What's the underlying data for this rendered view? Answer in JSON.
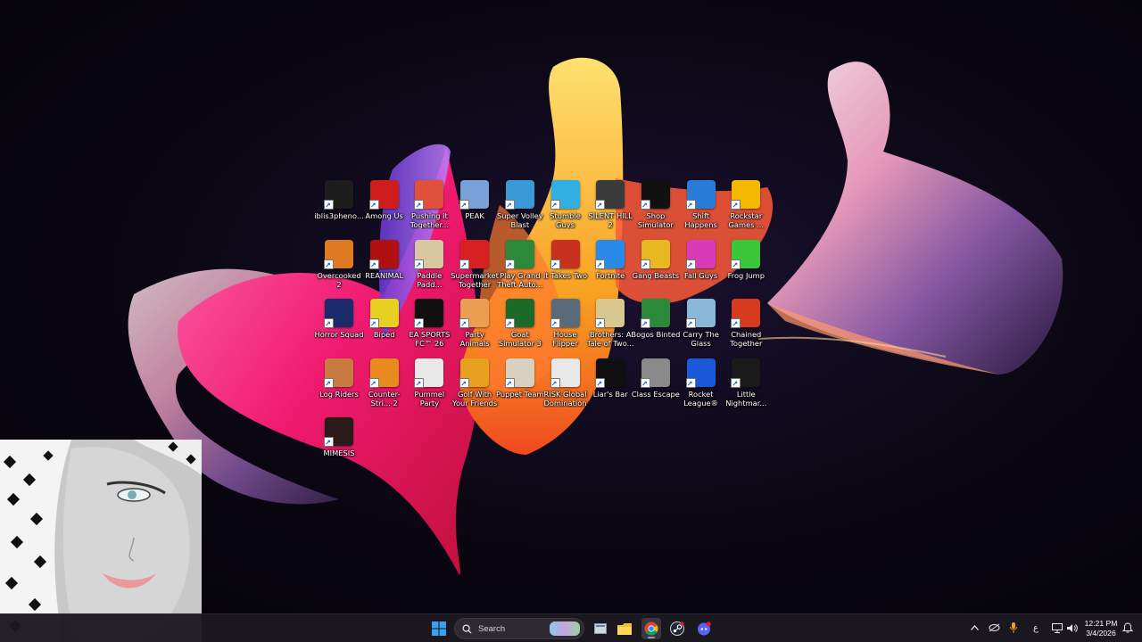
{
  "desktop": {
    "icons": [
      {
        "label": "iblis3pheno...",
        "icon": "iblis-icon",
        "color": "#1c1c1c"
      },
      {
        "label": "Among Us",
        "icon": "among-us-icon",
        "color": "#d01c1c"
      },
      {
        "label": "Pushing it Together...",
        "icon": "pushing-it-together-icon",
        "color": "#e0503a"
      },
      {
        "label": "PEAK",
        "icon": "peak-icon",
        "color": "#7aa0d8"
      },
      {
        "label": "Super Volley Blast",
        "icon": "super-volley-blast-icon",
        "color": "#3a9ad8"
      },
      {
        "label": "Stumble Guys",
        "icon": "stumble-guys-icon",
        "color": "#2fb0e0"
      },
      {
        "label": "SILENT HILL 2",
        "icon": "silent-hill-icon",
        "color": "#3a3a3a"
      },
      {
        "label": "Shop Simulator",
        "icon": "shop-simulator-icon",
        "color": "#111111"
      },
      {
        "label": "Shift Happens",
        "icon": "shift-happens-icon",
        "color": "#2a7ad8"
      },
      {
        "label": "Rockstar Games ...",
        "icon": "rockstar-games-icon",
        "color": "#f5b800"
      },
      {
        "label": "Overcooked 2",
        "icon": "overcooked-icon",
        "color": "#e07a20"
      },
      {
        "label": "REANIMAL",
        "icon": "reanimal-icon",
        "color": "#b01010"
      },
      {
        "label": "Paddle Padd...",
        "icon": "paddle-icon",
        "color": "#d8c8a0"
      },
      {
        "label": "Supermarket Together",
        "icon": "supermarket-together-icon",
        "color": "#d82020"
      },
      {
        "label": "Play Grand Theft Auto...",
        "icon": "gta-icon",
        "color": "#2a8a3a"
      },
      {
        "label": "It Takes Two",
        "icon": "it-takes-two-icon",
        "color": "#c83020"
      },
      {
        "label": "Fortnite",
        "icon": "fortnite-icon",
        "color": "#2a8ae8"
      },
      {
        "label": "Gang Beasts",
        "icon": "gang-beasts-icon",
        "color": "#e8b820"
      },
      {
        "label": "Fall Guys",
        "icon": "fall-guys-icon",
        "color": "#d83ab8"
      },
      {
        "label": "Frog Jump",
        "icon": "frog-jump-icon",
        "color": "#3ac83a"
      },
      {
        "label": "Horror Squad",
        "icon": "horror-squad-icon",
        "color": "#1a2a6a"
      },
      {
        "label": "Biped",
        "icon": "biped-icon",
        "color": "#e8d020"
      },
      {
        "label": "EA SPORTS FC™ 26",
        "icon": "ea-sports-fc-icon",
        "color": "#101010"
      },
      {
        "label": "Party Animals",
        "icon": "party-animals-icon",
        "color": "#e8a050"
      },
      {
        "label": "Goat Simulator 3",
        "icon": "goat-simulator-icon",
        "color": "#1a6a2a"
      },
      {
        "label": "House Flipper",
        "icon": "house-flipper-icon",
        "color": "#5a6a7a"
      },
      {
        "label": "Brothers: A Tale of Two...",
        "icon": "brothers-icon",
        "color": "#d8c890"
      },
      {
        "label": "Bogos Binted",
        "icon": "bogos-binted-icon",
        "color": "#2a8a3a"
      },
      {
        "label": "Carry The Glass",
        "icon": "carry-the-glass-icon",
        "color": "#8ab8d8"
      },
      {
        "label": "Chained Together",
        "icon": "chained-together-icon",
        "color": "#d83a20"
      },
      {
        "label": "Log Riders",
        "icon": "log-riders-icon",
        "color": "#c87a40"
      },
      {
        "label": "Counter-Stri... 2",
        "icon": "counter-strike-icon",
        "color": "#e88a20"
      },
      {
        "label": "Pummel Party",
        "icon": "pummel-party-icon",
        "color": "#e8e8e8"
      },
      {
        "label": "Golf With Your Friends",
        "icon": "golf-with-your-friends-icon",
        "color": "#e8a020"
      },
      {
        "label": "Puppet Team",
        "icon": "puppet-team-icon",
        "color": "#d8d0c0"
      },
      {
        "label": "RISK Global Domination",
        "icon": "risk-icon",
        "color": "#e8e8e8"
      },
      {
        "label": "Liar's Bar",
        "icon": "liars-bar-icon",
        "color": "#101010"
      },
      {
        "label": "Class Escape",
        "icon": "class-escape-icon",
        "color": "#8a8a8a"
      },
      {
        "label": "Rocket League®",
        "icon": "rocket-league-icon",
        "color": "#1a5ad8"
      },
      {
        "label": "Little Nightmar...",
        "icon": "little-nightmares-icon",
        "color": "#1a1a1a"
      },
      {
        "label": "MIMESIS",
        "icon": "mimesis-icon",
        "color": "#2a1a1a"
      }
    ]
  },
  "taskbar": {
    "search_label": "Search",
    "apps": [
      {
        "name": "file-explorer-view-icon"
      },
      {
        "name": "file-explorer-icon"
      },
      {
        "name": "chrome-icon"
      },
      {
        "name": "steam-icon"
      },
      {
        "name": "discord-icon"
      }
    ],
    "tray": {
      "keyboard_layout": "ع",
      "time": "12:21 PM",
      "date": "3/4/2026"
    }
  }
}
